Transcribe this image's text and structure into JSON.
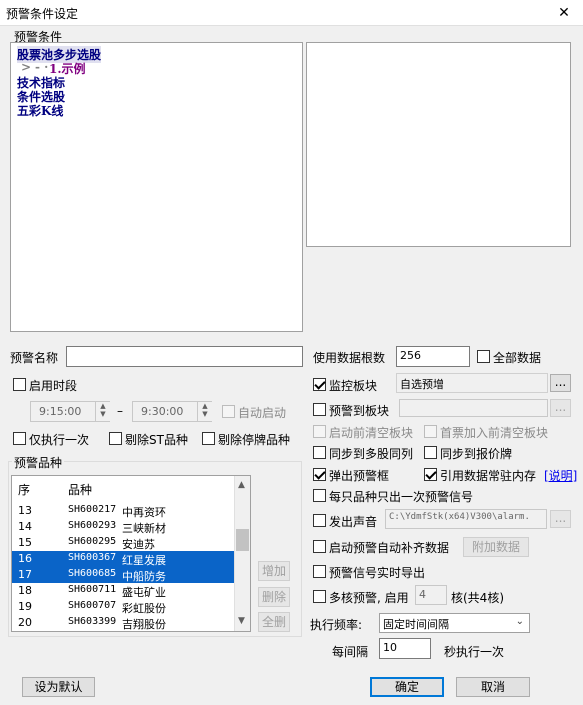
{
  "window": {
    "title": "预警条件设定",
    "close_glyph": "✕"
  },
  "conditions_group": {
    "label": "预警条件",
    "tree": [
      {
        "label": "股票池多步选股",
        "level": 0,
        "selected": true
      },
      {
        "label": "1.示例",
        "level": 1,
        "prefix": "- ·"
      },
      {
        "label": "技术指标",
        "level": 0
      },
      {
        "label": "条件选股",
        "level": 0
      },
      {
        "label": "五彩K线",
        "level": 0
      }
    ]
  },
  "alert_name": {
    "label": "预警名称",
    "value": ""
  },
  "data_count": {
    "label": "使用数据根数",
    "value": "256"
  },
  "all_data": {
    "label": "全部数据",
    "checked": false
  },
  "enable_time": {
    "label": "启用时段",
    "checked": false
  },
  "time_start": "9:15:00",
  "time_sep": "–",
  "time_end": "9:30:00",
  "auto_start": {
    "label": "自动启动",
    "checked": false
  },
  "once_only": {
    "label": "仅执行一次",
    "checked": false
  },
  "exclude_st": {
    "label": "剔除ST品种",
    "checked": false
  },
  "exclude_suspended": {
    "label": "剔除停牌品种",
    "checked": false
  },
  "monitor_block": {
    "label": "监控板块",
    "checked": true,
    "value": "自选预增",
    "btn": "..."
  },
  "alert_to_block": {
    "label": "预警到板块",
    "checked": false,
    "value": "",
    "btn": "..."
  },
  "clear_block_before": {
    "label": "启动前清空板块",
    "checked": false
  },
  "first_clear": {
    "label": "首票加入前清空板块",
    "checked": false
  },
  "sync_multi": {
    "label": "同步到多股同列",
    "checked": false
  },
  "sync_quote": {
    "label": "同步到报价牌",
    "checked": false
  },
  "popup": {
    "label": "弹出预警框",
    "checked": true
  },
  "ref_data": {
    "label": "引用数据常驻内存",
    "checked": true
  },
  "explain_link": "[说明]",
  "once_signal": {
    "label": "每只品种只出一次预警信号",
    "checked": false
  },
  "sound": {
    "label": "发出声音",
    "checked": false,
    "value": "C:\\YdmfStk(x64)V300\\alarm.",
    "btn": "..."
  },
  "auto_fill": {
    "label": "启动预警自动补齐数据",
    "checked": false
  },
  "addon_btn": "附加数据",
  "realtime_export": {
    "label": "预警信号实时导出",
    "checked": false
  },
  "multicore": {
    "label": "多核预警, 启用",
    "checked": false,
    "value": "4",
    "suffix": "核(共4核)"
  },
  "frequency": {
    "label": "执行频率:",
    "value": "固定时间间隔"
  },
  "interval": {
    "prefix": "每间隔",
    "value": "10",
    "suffix": "秒执行一次"
  },
  "products_group": {
    "label": "预警品种",
    "headers": [
      "序",
      "品种"
    ],
    "rows": [
      {
        "idx": "13",
        "code": "SH600217",
        "name": "中再资环",
        "selected": false
      },
      {
        "idx": "14",
        "code": "SH600293",
        "name": "三峡新材",
        "selected": false
      },
      {
        "idx": "15",
        "code": "SH600295",
        "name": "安迪苏",
        "selected": false
      },
      {
        "idx": "16",
        "code": "SH600367",
        "name": "红星发展",
        "selected": true
      },
      {
        "idx": "17",
        "code": "SH600685",
        "name": "中船防务",
        "selected": true
      },
      {
        "idx": "18",
        "code": "SH600711",
        "name": "盛屯矿业",
        "selected": false
      },
      {
        "idx": "19",
        "code": "SH600707",
        "name": "彩虹股份",
        "selected": false
      },
      {
        "idx": "20",
        "code": "SH603399",
        "name": "吉翔股份",
        "selected": false
      }
    ],
    "add_btn": "增加",
    "delete_btn": "删除",
    "delete_all_btn": "全删"
  },
  "set_default_btn": "设为默认",
  "ok_btn": "确定",
  "cancel_btn": "取消"
}
